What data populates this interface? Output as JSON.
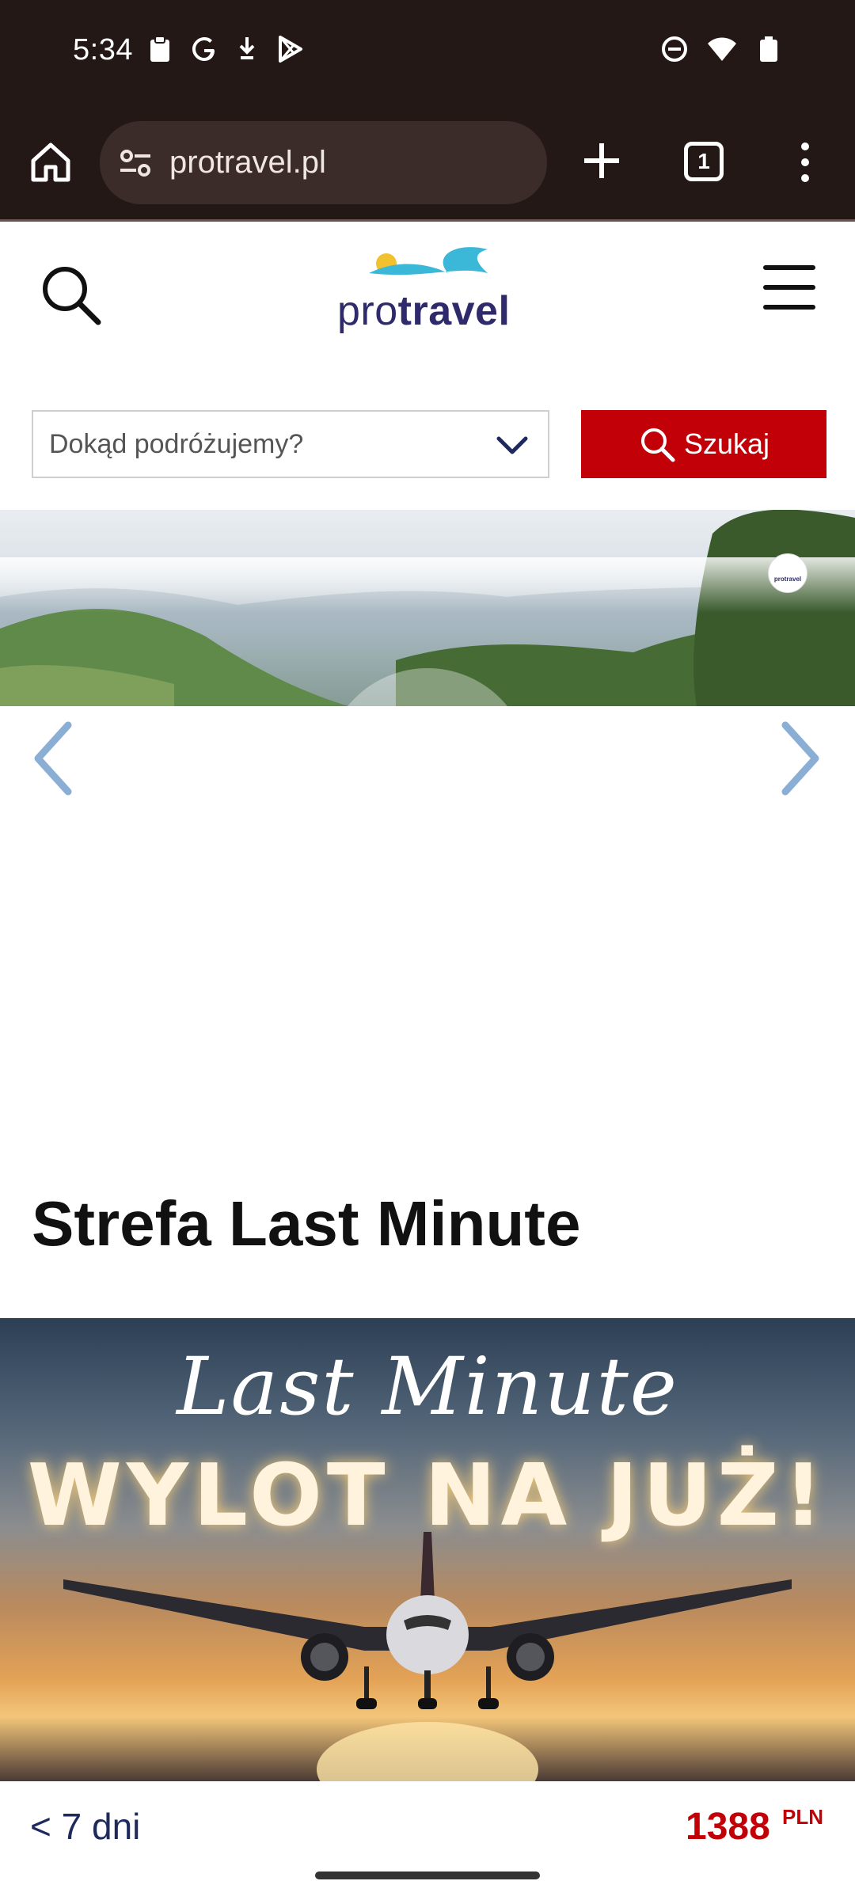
{
  "status_bar": {
    "time": "5:34"
  },
  "browser": {
    "url": "protravel.pl",
    "tab_count": "1"
  },
  "site": {
    "logo": {
      "pro": "pro",
      "travel": "travel"
    },
    "search": {
      "destination_placeholder": "Dokąd podróżujemy?",
      "button_label": "Szukaj"
    },
    "hero_badge": "protravel",
    "section_title": "Strefa Last Minute",
    "last_minute_banner": {
      "script_text": "Last Minute",
      "headline": "WYLOT NA JUŻ!"
    },
    "offer": {
      "duration": "< 7 dni",
      "price": "1388",
      "currency": "PLN"
    }
  },
  "colors": {
    "brand_red": "#c10007",
    "brand_navy": "#2e2a6b",
    "browser_chrome": "#241816",
    "logo_wave": "#3bb7d8",
    "logo_sun": "#f2c12e"
  },
  "icons": [
    "home-icon",
    "site-settings-icon",
    "plus-icon",
    "tabs-icon",
    "more-vert-icon",
    "search-icon",
    "hamburger-icon",
    "chevron-down-icon",
    "chevron-left-icon",
    "chevron-right-icon"
  ]
}
